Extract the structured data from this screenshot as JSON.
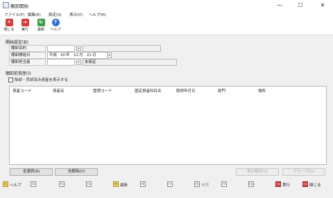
{
  "window": {
    "title": "棚卸開始",
    "controls": {
      "minimize": "—",
      "maximize": "☐",
      "close": "✕"
    }
  },
  "menu": [
    "ファイル(F)",
    "編集(E)",
    "設定(S)",
    "表示(V)",
    "ヘルプ(H)"
  ],
  "toolbar": {
    "close": "閉じる",
    "execute": "実行",
    "refresh": "最新",
    "help": "ヘルプ"
  },
  "start_settings": {
    "title": "開始設定(B)",
    "purpose_label": "棚卸目的",
    "date_label": "棚卸開始日",
    "era": "平成",
    "year": "30",
    "year_unit": "年",
    "month": "12",
    "month_unit": "月",
    "day": "21",
    "day_unit": "日",
    "person_label": "棚卸担当者",
    "person_value": "未設定"
  },
  "assets": {
    "title": "棚卸前資産(I)",
    "checkbox_label": "除却・売却済み資産を表示する",
    "columns": [
      "資産コード",
      "資産名",
      "管理コード",
      "固定資産科目名",
      "取得年月日",
      "部門",
      "場所"
    ]
  },
  "buttons": {
    "select_all": "全選択(A)",
    "deselect_all": "全解除(U)",
    "display_order": "表示順序(O)",
    "group": "グループ(G)"
  },
  "fkeys": [
    {
      "key": "F1",
      "label": "ヘルプ"
    },
    {
      "key": "F2",
      "label": ""
    },
    {
      "key": "F3",
      "label": ""
    },
    {
      "key": "F4",
      "label": ""
    },
    {
      "key": "F5",
      "label": "最新"
    },
    {
      "key": "F6",
      "label": ""
    },
    {
      "key": "F7",
      "label": ""
    },
    {
      "key": "F8",
      "label": "参照"
    },
    {
      "key": "F9",
      "label": ""
    },
    {
      "key": "F10",
      "label": ""
    },
    {
      "key": "F11",
      "label": "実行"
    },
    {
      "key": "F12",
      "label": "閉じる"
    }
  ]
}
